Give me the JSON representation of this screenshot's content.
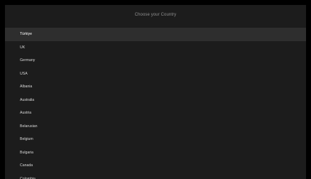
{
  "header": {
    "title": "Choose your Country"
  },
  "countries": [
    {
      "label": "Türkiye",
      "selected": true
    },
    {
      "label": "UK"
    },
    {
      "label": "Germany"
    },
    {
      "label": "USA"
    },
    {
      "label": "Albania"
    },
    {
      "label": "Australia"
    },
    {
      "label": "Austria"
    },
    {
      "label": "Belarusian"
    },
    {
      "label": "Belgium"
    },
    {
      "label": "Bulgaria"
    },
    {
      "label": "Canada"
    },
    {
      "label": "Colombia"
    }
  ],
  "colors": {
    "background": "#000000",
    "panel": "#1c1c1c",
    "selected_row": "#2e2e2e"
  }
}
